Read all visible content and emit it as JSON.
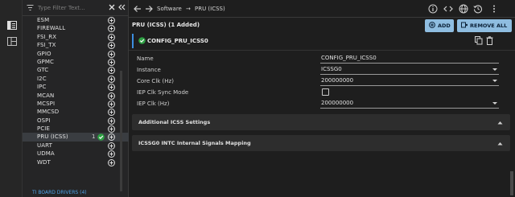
{
  "sidebar": {
    "filter_placeholder": "Type Filter Text...",
    "modules": [
      {
        "label": "ESM",
        "count": "",
        "checked": false,
        "selected": false
      },
      {
        "label": "FIREWALL",
        "count": "",
        "checked": false,
        "selected": false
      },
      {
        "label": "FSI_RX",
        "count": "",
        "checked": false,
        "selected": false
      },
      {
        "label": "FSI_TX",
        "count": "",
        "checked": false,
        "selected": false
      },
      {
        "label": "GPIO",
        "count": "",
        "checked": false,
        "selected": false
      },
      {
        "label": "GPMC",
        "count": "",
        "checked": false,
        "selected": false
      },
      {
        "label": "GTC",
        "count": "",
        "checked": false,
        "selected": false
      },
      {
        "label": "I2C",
        "count": "",
        "checked": false,
        "selected": false
      },
      {
        "label": "IPC",
        "count": "",
        "checked": false,
        "selected": false
      },
      {
        "label": "MCAN",
        "count": "",
        "checked": false,
        "selected": false
      },
      {
        "label": "MCSPI",
        "count": "",
        "checked": false,
        "selected": false
      },
      {
        "label": "MMCSD",
        "count": "",
        "checked": false,
        "selected": false
      },
      {
        "label": "OSPI",
        "count": "",
        "checked": false,
        "selected": false
      },
      {
        "label": "PCIE",
        "count": "",
        "checked": false,
        "selected": false
      },
      {
        "label": "PRU (ICSS)",
        "count": "1",
        "checked": true,
        "selected": true
      },
      {
        "label": "UART",
        "count": "",
        "checked": false,
        "selected": false
      },
      {
        "label": "UDMA",
        "count": "",
        "checked": false,
        "selected": false
      },
      {
        "label": "WDT",
        "count": "",
        "checked": false,
        "selected": false
      }
    ],
    "board_drivers": "TI BOARD DRIVERS (4)"
  },
  "breadcrumb": {
    "part1": "Software",
    "separator": "→",
    "part2": "PRU (ICSS)"
  },
  "header": {
    "title": "PRU (ICSS) (1 Added)",
    "add_label": "ADD",
    "remove_all_label": "REMOVE ALL"
  },
  "instance": {
    "name": "CONFIG_PRU_ICSS0"
  },
  "fields": [
    {
      "label": "Name",
      "value": "CONFIG_PRU_ICSS0",
      "type": "text"
    },
    {
      "label": "Instance",
      "value": "ICSSG0",
      "type": "select"
    },
    {
      "label": "Core Clk (Hz)",
      "value": "200000000",
      "type": "select"
    },
    {
      "label": "IEP Clk Sync Mode",
      "value": "",
      "type": "checkbox"
    },
    {
      "label": "IEP Clk (Hz)",
      "value": "200000000",
      "type": "select"
    }
  ],
  "panels": [
    {
      "label": "Additional ICSS Settings"
    },
    {
      "label": "ICSSG0 INTC Internal Signals Mapping"
    }
  ],
  "colors": {
    "accent": "#8fbde0",
    "check_green": "#2ea043",
    "link_blue": "#4ea3e8"
  }
}
